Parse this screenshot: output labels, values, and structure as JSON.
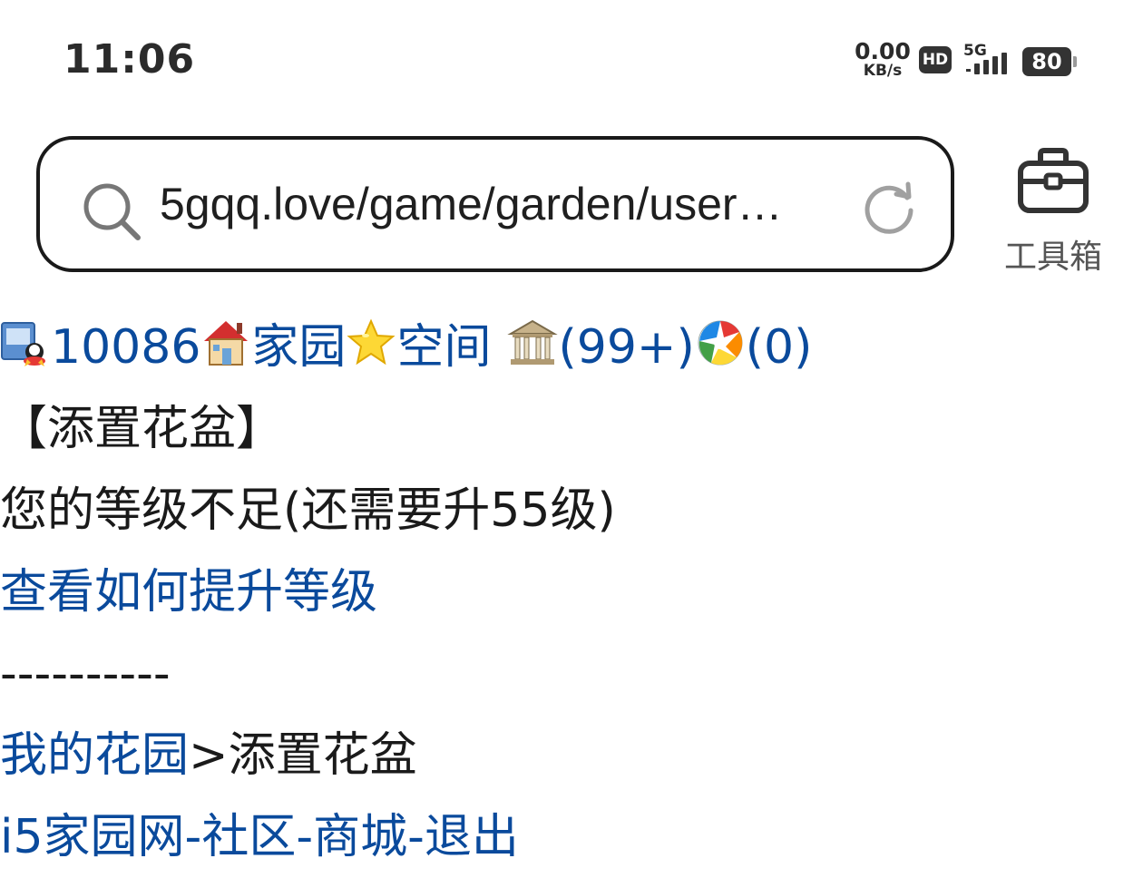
{
  "status_bar": {
    "time": "11:06",
    "net_speed": "0.00",
    "net_unit": "KB/s",
    "hd_badge": "HD",
    "network_gen": "5G",
    "battery": "80",
    "icons": [
      "hd-badge-icon",
      "signal-5g-icon",
      "battery-icon"
    ]
  },
  "browser": {
    "url": "5gqq.love/game/garden/user…",
    "toolbox_label": "工具箱",
    "icons": [
      "search-icon",
      "refresh-icon",
      "toolbox-icon"
    ]
  },
  "nav_bar": {
    "user_id": "10086",
    "home_label": "家园",
    "space_label": "空间",
    "mail_count": "(99+)",
    "album_count": "(0)",
    "icons": [
      "user-avatar-icon",
      "house-icon",
      "star-icon",
      "building-icon",
      "camera-shutter-icon"
    ]
  },
  "page": {
    "title": "【添置花盆】",
    "level_message": "您的等级不足(还需要升55级)",
    "upgrade_link": "查看如何提升等级",
    "divider": "----------",
    "breadcrumb": {
      "parent": "我的花园",
      "separator": ">",
      "current": "添置花盆"
    }
  },
  "footer": {
    "home_link": "i5家园网",
    "community_link": "社区",
    "shop_link": "商城",
    "logout_link": "退出",
    "separator": "-"
  },
  "colors": {
    "link": "#0a4a9c",
    "text": "#1a1a1a",
    "border": "#1a1a1a"
  }
}
